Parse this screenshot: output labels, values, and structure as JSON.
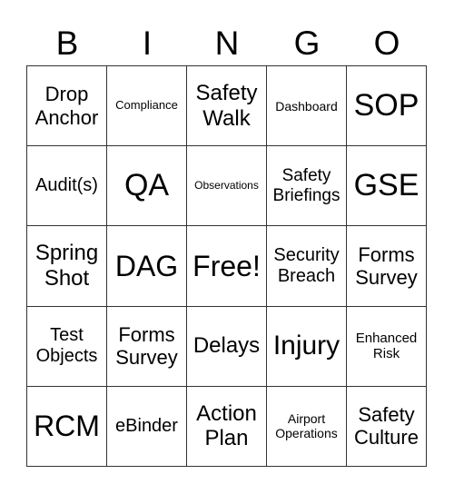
{
  "header": [
    "B",
    "I",
    "N",
    "G",
    "O"
  ],
  "cells": [
    "Drop Anchor",
    "Compliance",
    "Safety Walk",
    "Dashboard",
    "SOP",
    "Audit(s)",
    "QA",
    "Observations",
    "Safety Briefings",
    "GSE",
    "Spring Shot",
    "DAG",
    "Free!",
    "Security Breach",
    "Forms Survey",
    "Test Objects",
    "Forms Survey",
    "Delays",
    "Injury",
    "Enhanced Risk",
    "RCM",
    "eBinder",
    "Action Plan",
    "Airport Operations",
    "Safety Culture"
  ]
}
